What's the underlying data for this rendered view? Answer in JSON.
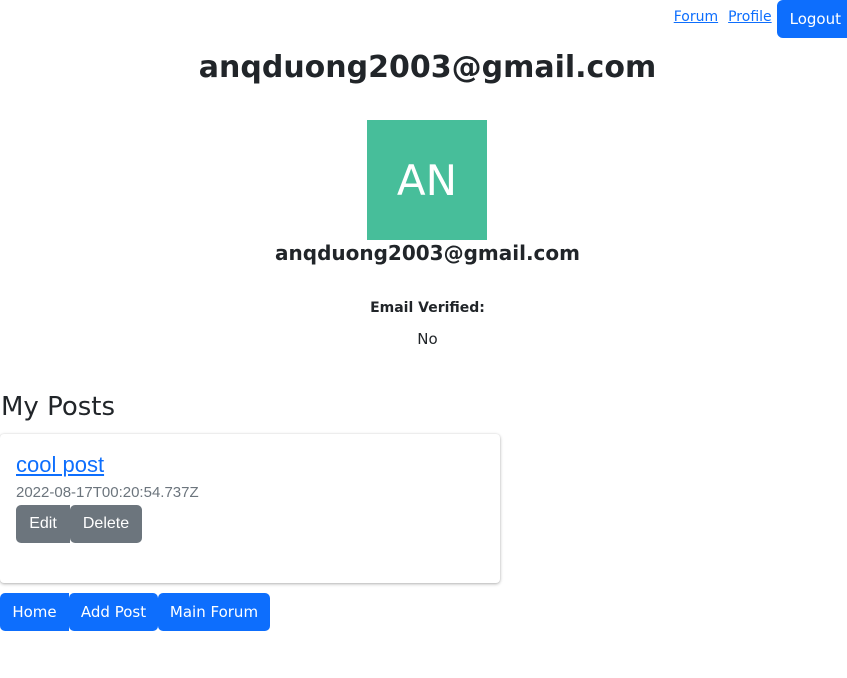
{
  "nav": {
    "forum_link": "Forum",
    "profile_link": "Profile",
    "logout_label": "Logout"
  },
  "page": {
    "title": "anqduong2003@gmail.com"
  },
  "profile": {
    "avatar_initials": "AN",
    "avatar_color": "#47be9a",
    "name": "anqduong2003@gmail.com",
    "email_verified_label": "Email Verified:",
    "email_verified_value": "No"
  },
  "posts": {
    "section_title": "My Posts",
    "items": [
      {
        "title": "cool post",
        "timestamp": "2022-08-17T00:20:54.737Z",
        "edit_label": "Edit",
        "delete_label": "Delete"
      }
    ]
  },
  "footer_actions": {
    "home_label": "Home",
    "add_post_label": "Add Post",
    "main_forum_label": "Main Forum"
  },
  "colors": {
    "primary": "#0d6efd",
    "secondary": "#6c757d",
    "avatar": "#47be9a"
  }
}
